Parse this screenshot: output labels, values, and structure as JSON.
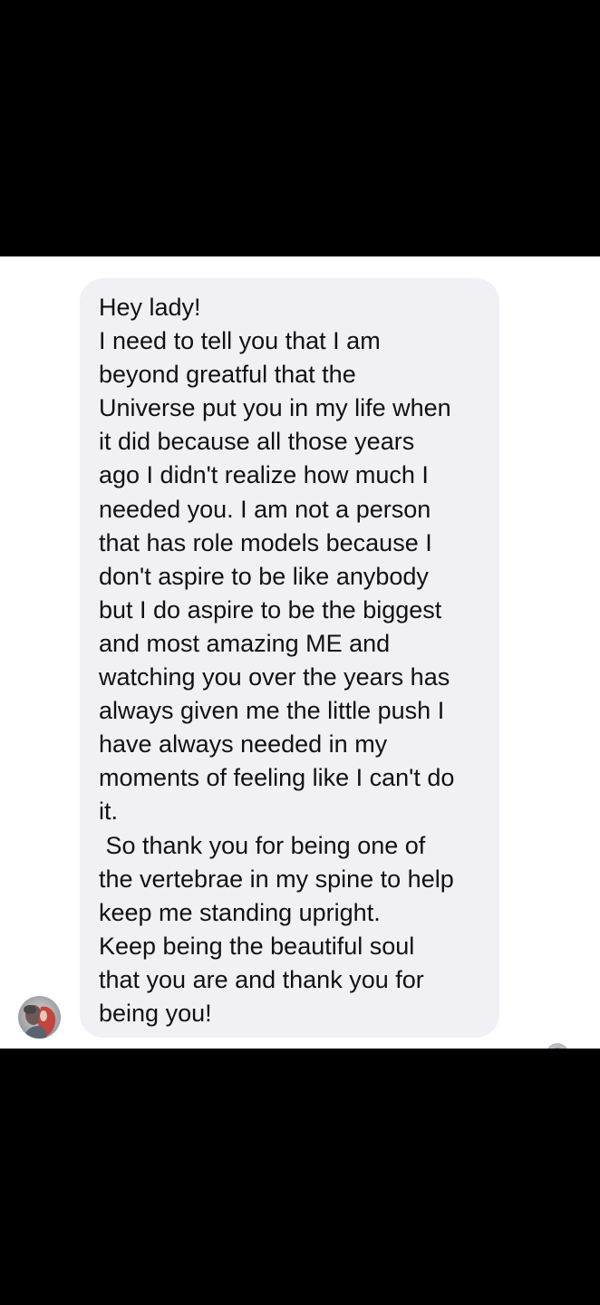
{
  "conversation": {
    "message": {
      "lines": [
        "Hey lady!",
        "I need to tell you that I am",
        "beyond greatful that the",
        "Universe put you in my life when",
        "it did because all those years",
        "ago I didn't realize how much I",
        "needed you. I am not a person",
        "that has role models because I",
        "don't aspire to be like anybody",
        "but I do aspire to be the biggest",
        "and most amazing ME and",
        "watching you over the years has",
        "always given me the little push I",
        "have always needed in my",
        "moments of feeling like I can't do",
        "it.",
        " So thank you for being one of",
        "the vertebrae in my spine to help",
        "keep me standing upright.",
        "Keep being the beautiful soul",
        "that you are and thank you for",
        "being you!"
      ]
    },
    "sender_avatar_icon": "profile-photo-icon",
    "read_receipt_icon": "seen-avatar-icon"
  },
  "colors": {
    "letterbox": "#000000",
    "chat_background": "#ffffff",
    "bubble_background": "#f0f0f5",
    "message_text": "#111111"
  }
}
